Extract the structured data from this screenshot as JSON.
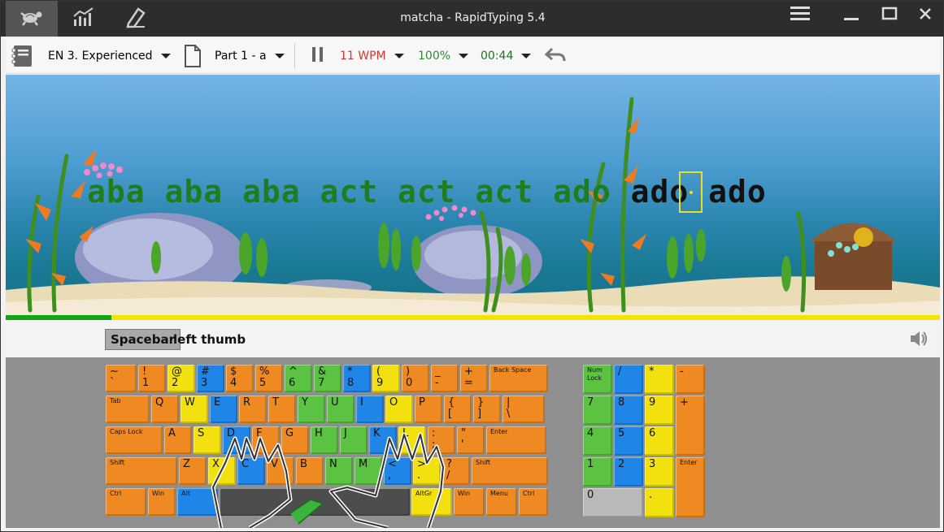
{
  "window": {
    "title": "matcha - RapidTyping 5.4"
  },
  "titlebar_tabs": [
    {
      "icon": "turtle-icon"
    },
    {
      "icon": "statistics-icon"
    },
    {
      "icon": "editor-icon"
    }
  ],
  "toolbar": {
    "course": "EN 3. Experienced",
    "lesson": "Part 1 - a",
    "speed": "11 WPM",
    "accuracy": "100%",
    "time": "00:44",
    "colors": {
      "speed": "#d9342b",
      "accuracy": "#2e8b2e",
      "time": "#1e6e1e"
    }
  },
  "lesson": {
    "typed": "aba aba aba act act act ado",
    "current": " ",
    "remaining": "ado ado",
    "progress_fraction": 0.113
  },
  "hint": {
    "key": "Spacebar",
    "finger": "left thumb"
  },
  "keyboard": {
    "row1": [
      {
        "id": "tilde",
        "top": "~",
        "bot": "`"
      },
      {
        "id": "1",
        "top": "!",
        "bot": "1"
      },
      {
        "id": "2",
        "top": "@",
        "bot": "2"
      },
      {
        "id": "3",
        "top": "#",
        "bot": "3"
      },
      {
        "id": "4",
        "top": "$",
        "bot": "4"
      },
      {
        "id": "5",
        "top": "%",
        "bot": "5"
      },
      {
        "id": "6",
        "top": "^",
        "bot": "6"
      },
      {
        "id": "7",
        "top": "&",
        "bot": "7"
      },
      {
        "id": "8",
        "top": "*",
        "bot": "8"
      },
      {
        "id": "9",
        "top": "(",
        "bot": "9"
      },
      {
        "id": "0",
        "top": ")",
        "bot": "0"
      },
      {
        "id": "minus",
        "top": "_",
        "bot": "-"
      },
      {
        "id": "equals",
        "top": "+",
        "bot": "="
      },
      {
        "id": "backspace",
        "label": "Back Space"
      }
    ],
    "row2": [
      {
        "id": "tab",
        "label": "Tab"
      },
      {
        "id": "q",
        "top": "Q"
      },
      {
        "id": "w",
        "top": "W"
      },
      {
        "id": "e",
        "top": "E"
      },
      {
        "id": "r",
        "top": "R"
      },
      {
        "id": "t",
        "top": "T"
      },
      {
        "id": "yk",
        "top": "Y"
      },
      {
        "id": "u",
        "top": "U"
      },
      {
        "id": "i",
        "top": "I"
      },
      {
        "id": "ok",
        "top": "O"
      },
      {
        "id": "p",
        "top": "P"
      },
      {
        "id": "lbrace",
        "top": "{",
        "bot": "["
      },
      {
        "id": "rbrace",
        "top": "}",
        "bot": "]"
      },
      {
        "id": "pipe",
        "top": "|",
        "bot": "\\"
      }
    ],
    "row3": [
      {
        "id": "caps",
        "label": "Caps Lock"
      },
      {
        "id": "a",
        "top": "A"
      },
      {
        "id": "s",
        "top": "S"
      },
      {
        "id": "d",
        "top": "D"
      },
      {
        "id": "f",
        "top": "F"
      },
      {
        "id": "gk",
        "top": "G"
      },
      {
        "id": "h",
        "top": "H"
      },
      {
        "id": "j",
        "top": "J"
      },
      {
        "id": "k",
        "top": "K"
      },
      {
        "id": "l",
        "top": "L"
      },
      {
        "id": "semi",
        "top": ":",
        "bot": ";"
      },
      {
        "id": "quote",
        "top": "\"",
        "bot": "'"
      },
      {
        "id": "enter",
        "label": "Enter"
      }
    ],
    "row4": [
      {
        "id": "lshift",
        "label": "Shift"
      },
      {
        "id": "z",
        "top": "Z"
      },
      {
        "id": "x",
        "top": "X"
      },
      {
        "id": "c",
        "top": "C"
      },
      {
        "id": "v",
        "top": "V"
      },
      {
        "id": "bk",
        "top": "B"
      },
      {
        "id": "n",
        "top": "N"
      },
      {
        "id": "m",
        "top": "M"
      },
      {
        "id": "comma",
        "top": "<",
        "bot": ","
      },
      {
        "id": "period",
        "top": ">",
        "bot": "."
      },
      {
        "id": "slash",
        "top": "?",
        "bot": "/"
      },
      {
        "id": "rshift",
        "label": "Shift"
      }
    ],
    "row5": [
      {
        "id": "lctrl",
        "label": "Ctrl"
      },
      {
        "id": "lwin",
        "label": "Win"
      },
      {
        "id": "lalt",
        "label": "Alt"
      },
      {
        "id": "space",
        "label": ""
      },
      {
        "id": "altgr",
        "label": "AltGr"
      },
      {
        "id": "rwin",
        "label": "Win"
      },
      {
        "id": "menu",
        "label": "Menu"
      },
      {
        "id": "rctrl",
        "label": "Ctrl"
      }
    ],
    "numpad": [
      {
        "id": "numlock",
        "label": "Num Lock"
      },
      {
        "id": "ndiv",
        "top": "/"
      },
      {
        "id": "nmul",
        "top": "*"
      },
      {
        "id": "nminus",
        "top": "-"
      },
      {
        "id": "n7",
        "top": "7"
      },
      {
        "id": "n8",
        "top": "8"
      },
      {
        "id": "n9",
        "top": "9"
      },
      {
        "id": "nplus",
        "top": "+"
      },
      {
        "id": "n4",
        "top": "4"
      },
      {
        "id": "n5",
        "top": "5"
      },
      {
        "id": "n6",
        "top": "6"
      },
      {
        "id": "n1",
        "top": "1"
      },
      {
        "id": "n2",
        "top": "2"
      },
      {
        "id": "n3",
        "top": "3"
      },
      {
        "id": "nenter",
        "label": "Enter"
      },
      {
        "id": "n0",
        "top": "0"
      },
      {
        "id": "ndot",
        "top": "."
      }
    ]
  }
}
